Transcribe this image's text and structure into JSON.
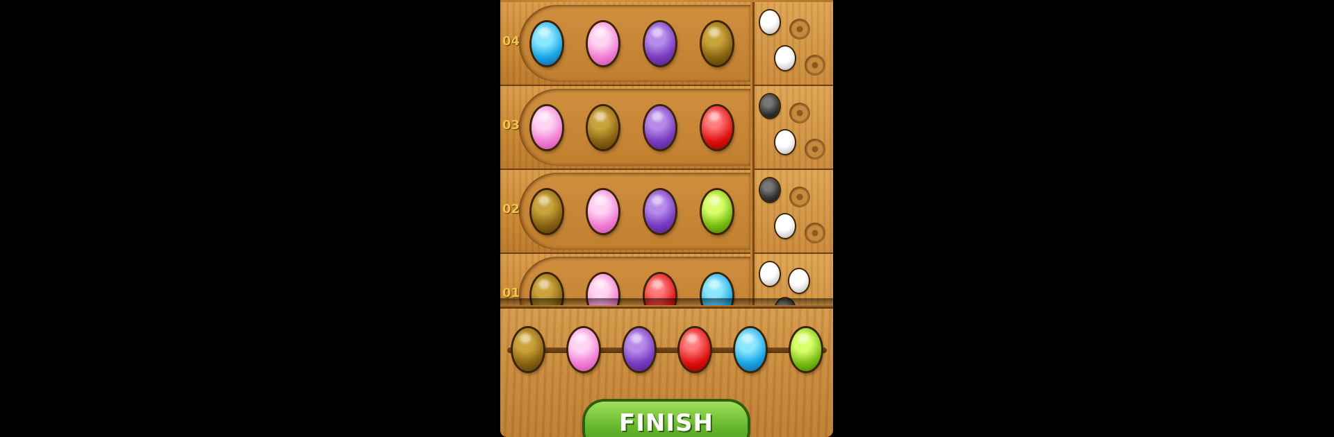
{
  "rows": [
    {
      "number": "04",
      "pegs": [
        "blue",
        "pink",
        "purple",
        "brown"
      ],
      "feedback": [
        "white",
        "empty",
        "white",
        "empty"
      ]
    },
    {
      "number": "03",
      "pegs": [
        "pink",
        "brown",
        "purple",
        "red"
      ],
      "feedback": [
        "black",
        "empty",
        "white",
        "empty"
      ]
    },
    {
      "number": "02",
      "pegs": [
        "brown",
        "pink",
        "purple",
        "green"
      ],
      "feedback": [
        "black",
        "empty",
        "white",
        "empty"
      ]
    },
    {
      "number": "01",
      "pegs": [
        "brown",
        "pink",
        "red",
        "blue"
      ],
      "feedback": [
        "white",
        "white",
        "black",
        "empty"
      ]
    }
  ],
  "palette": [
    "brown",
    "pink",
    "purple",
    "red",
    "blue",
    "green"
  ],
  "finish_button": "FINISH"
}
